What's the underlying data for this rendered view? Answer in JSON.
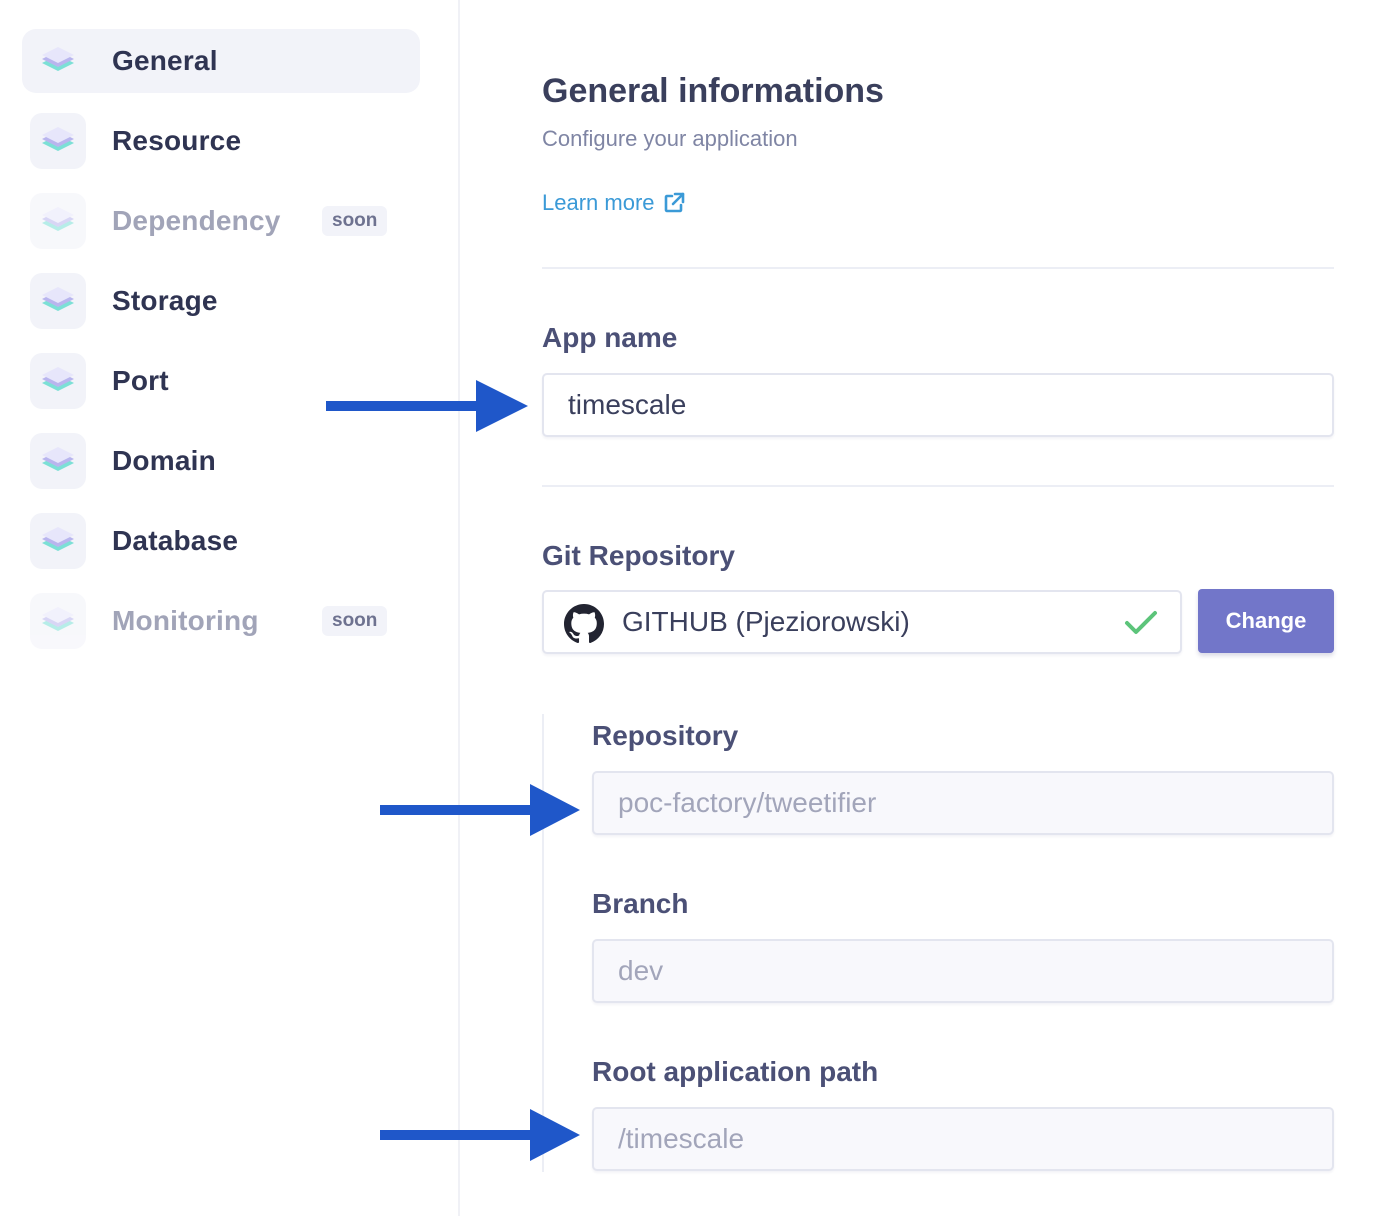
{
  "sidebar": {
    "items": [
      {
        "label": "General",
        "active": true,
        "disabled": false
      },
      {
        "label": "Resource",
        "active": false,
        "disabled": false
      },
      {
        "label": "Dependency",
        "active": false,
        "disabled": true,
        "badge": "soon"
      },
      {
        "label": "Storage",
        "active": false,
        "disabled": false
      },
      {
        "label": "Port",
        "active": false,
        "disabled": false
      },
      {
        "label": "Domain",
        "active": false,
        "disabled": false
      },
      {
        "label": "Database",
        "active": false,
        "disabled": false
      },
      {
        "label": "Monitoring",
        "active": false,
        "disabled": true,
        "badge": "soon"
      }
    ]
  },
  "main": {
    "title": "General informations",
    "subtitle": "Configure your application",
    "learn_more": "Learn more",
    "app_name": {
      "label": "App name",
      "value": "timescale"
    },
    "git": {
      "label": "Git Repository",
      "provider_text": "GITHUB (Pjeziorowski)",
      "change_label": "Change",
      "connected": true
    },
    "repository": {
      "label": "Repository",
      "value": "poc-factory/tweetifier"
    },
    "branch": {
      "label": "Branch",
      "value": "dev"
    },
    "root_path": {
      "label": "Root application path",
      "value": "/timescale"
    }
  },
  "colors": {
    "accent": "#7276c9",
    "link": "#3b9ad7",
    "check": "#5cc47a",
    "arrow": "#1f57c9"
  },
  "icons": {
    "nav": "layers-icon",
    "learn_more": "external-link-icon",
    "git": "github-icon",
    "status": "check-icon"
  }
}
